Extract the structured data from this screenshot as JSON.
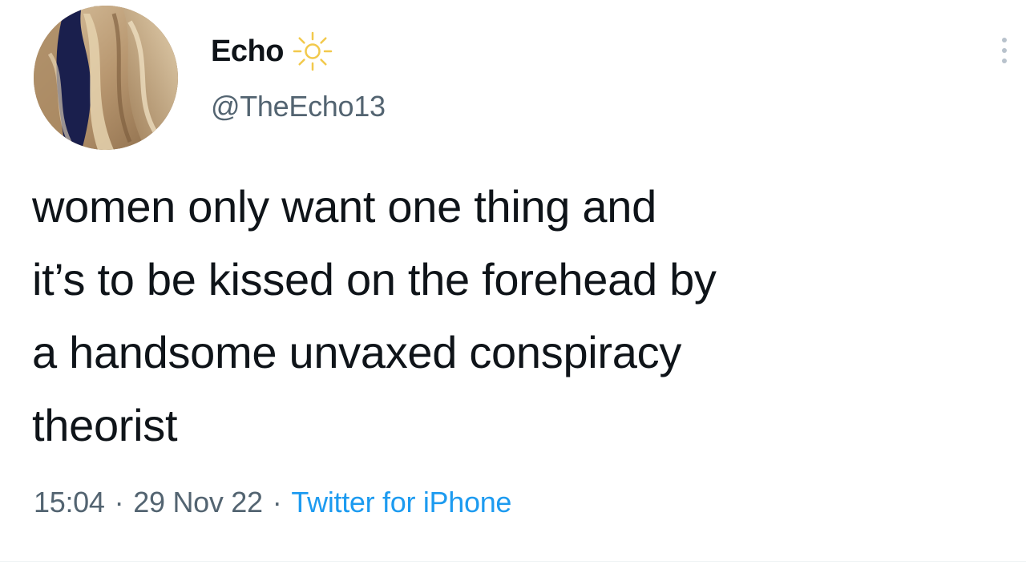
{
  "author": {
    "display_name": "Echo",
    "handle": "@TheEcho13",
    "name_emoji": "sun-icon"
  },
  "tweet": {
    "lines": [
      "women only want one thing and",
      "it’s to be kissed on the forehead by",
      "a handsome unvaxed conspiracy",
      "theorist"
    ]
  },
  "meta": {
    "time": "15:04",
    "separator": "·",
    "date": "29 Nov 22",
    "source": "Twitter for iPhone"
  },
  "colors": {
    "text": "#0f1419",
    "secondary": "#536471",
    "link": "#1d9bf0",
    "sun": "#f2c94c"
  }
}
